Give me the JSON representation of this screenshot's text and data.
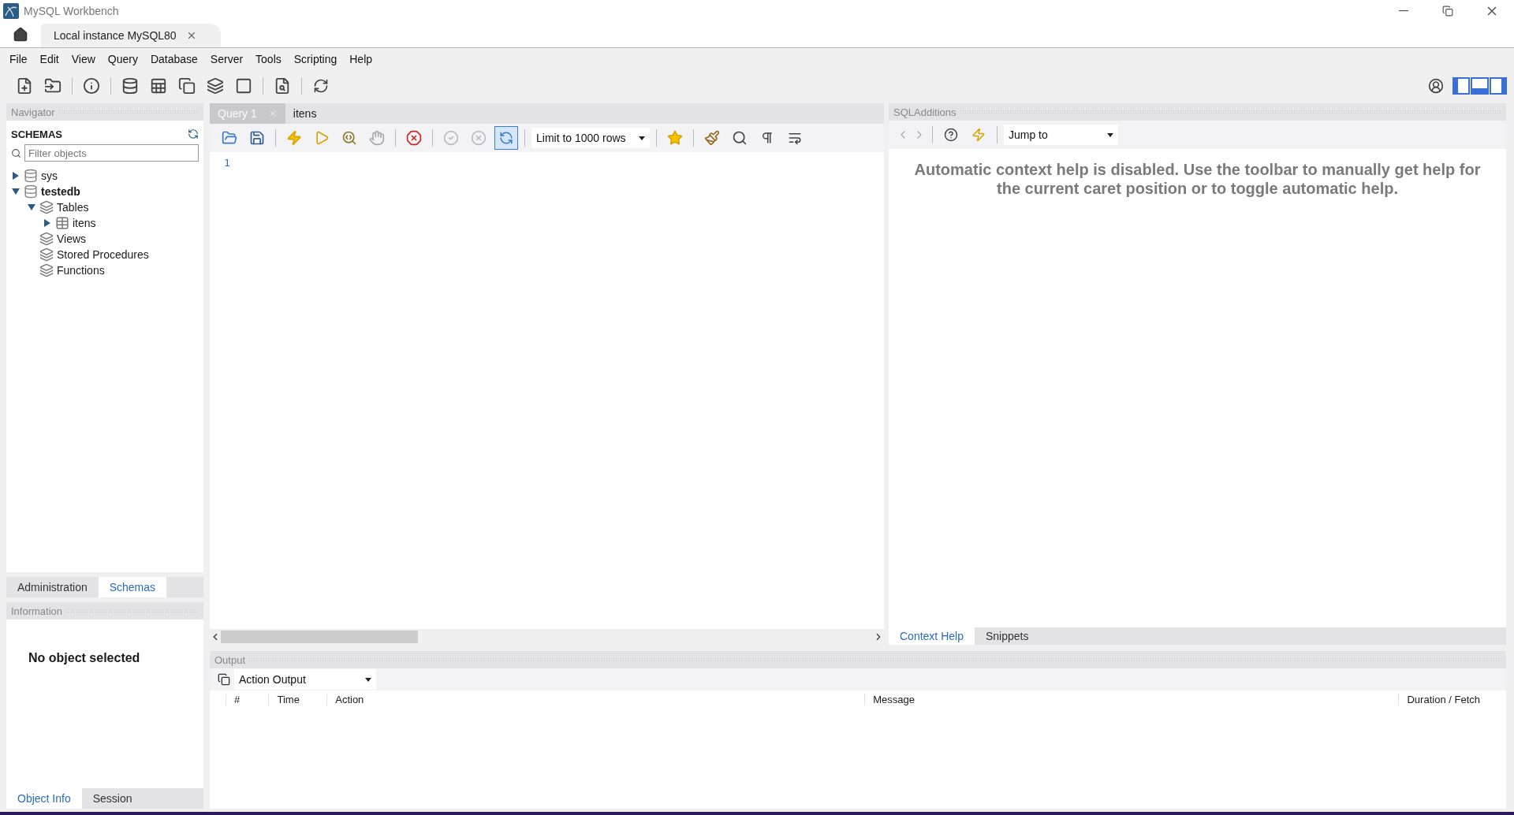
{
  "window": {
    "title": "MySQL Workbench"
  },
  "connection_tabs": [
    {
      "label": "Local instance MySQL80",
      "selected": true
    }
  ],
  "menu": [
    "File",
    "Edit",
    "View",
    "Query",
    "Database",
    "Server",
    "Tools",
    "Scripting",
    "Help"
  ],
  "navigator": {
    "title": "Navigator",
    "section": "SCHEMAS",
    "filter": {
      "placeholder": "Filter objects"
    },
    "tree": [
      {
        "label": "sys",
        "kind": "schema",
        "default": false,
        "expanded": false
      },
      {
        "label": "testedb",
        "kind": "schema",
        "default": true,
        "expanded": true,
        "children": [
          {
            "label": "Tables",
            "kind": "folder",
            "expanded": true,
            "children": [
              {
                "label": "itens",
                "kind": "table",
                "expanded": false
              }
            ]
          },
          {
            "label": "Views",
            "kind": "folder"
          },
          {
            "label": "Stored Procedures",
            "kind": "folder"
          },
          {
            "label": "Functions",
            "kind": "folder"
          }
        ]
      }
    ],
    "tabs": [
      {
        "label": "Administration",
        "selected": false
      },
      {
        "label": "Schemas",
        "selected": true
      }
    ]
  },
  "information": {
    "title": "Information",
    "message": "No object selected",
    "tabs": [
      {
        "label": "Object Info",
        "selected": true
      },
      {
        "label": "Session",
        "selected": false
      }
    ]
  },
  "editor": {
    "tabs": [
      {
        "label": "Query 1",
        "selected": true,
        "closable": true
      },
      {
        "label": "itens",
        "selected": false,
        "closable": false
      }
    ],
    "autocommit_pressed": true,
    "limit": "Limit to 1000 rows",
    "line_numbers": [
      "1"
    ]
  },
  "sql_additions": {
    "title": "SQLAdditions",
    "jump_to": "Jump to",
    "help_text": "Automatic context help is disabled. Use the toolbar to manually get help for the current caret position or to toggle automatic help.",
    "tabs": [
      {
        "label": "Context Help",
        "selected": true
      },
      {
        "label": "Snippets",
        "selected": false
      }
    ]
  },
  "output": {
    "title": "Output",
    "selector": "Action Output",
    "columns": [
      "#",
      "Time",
      "Action",
      "Message",
      "Duration / Fetch"
    ]
  }
}
